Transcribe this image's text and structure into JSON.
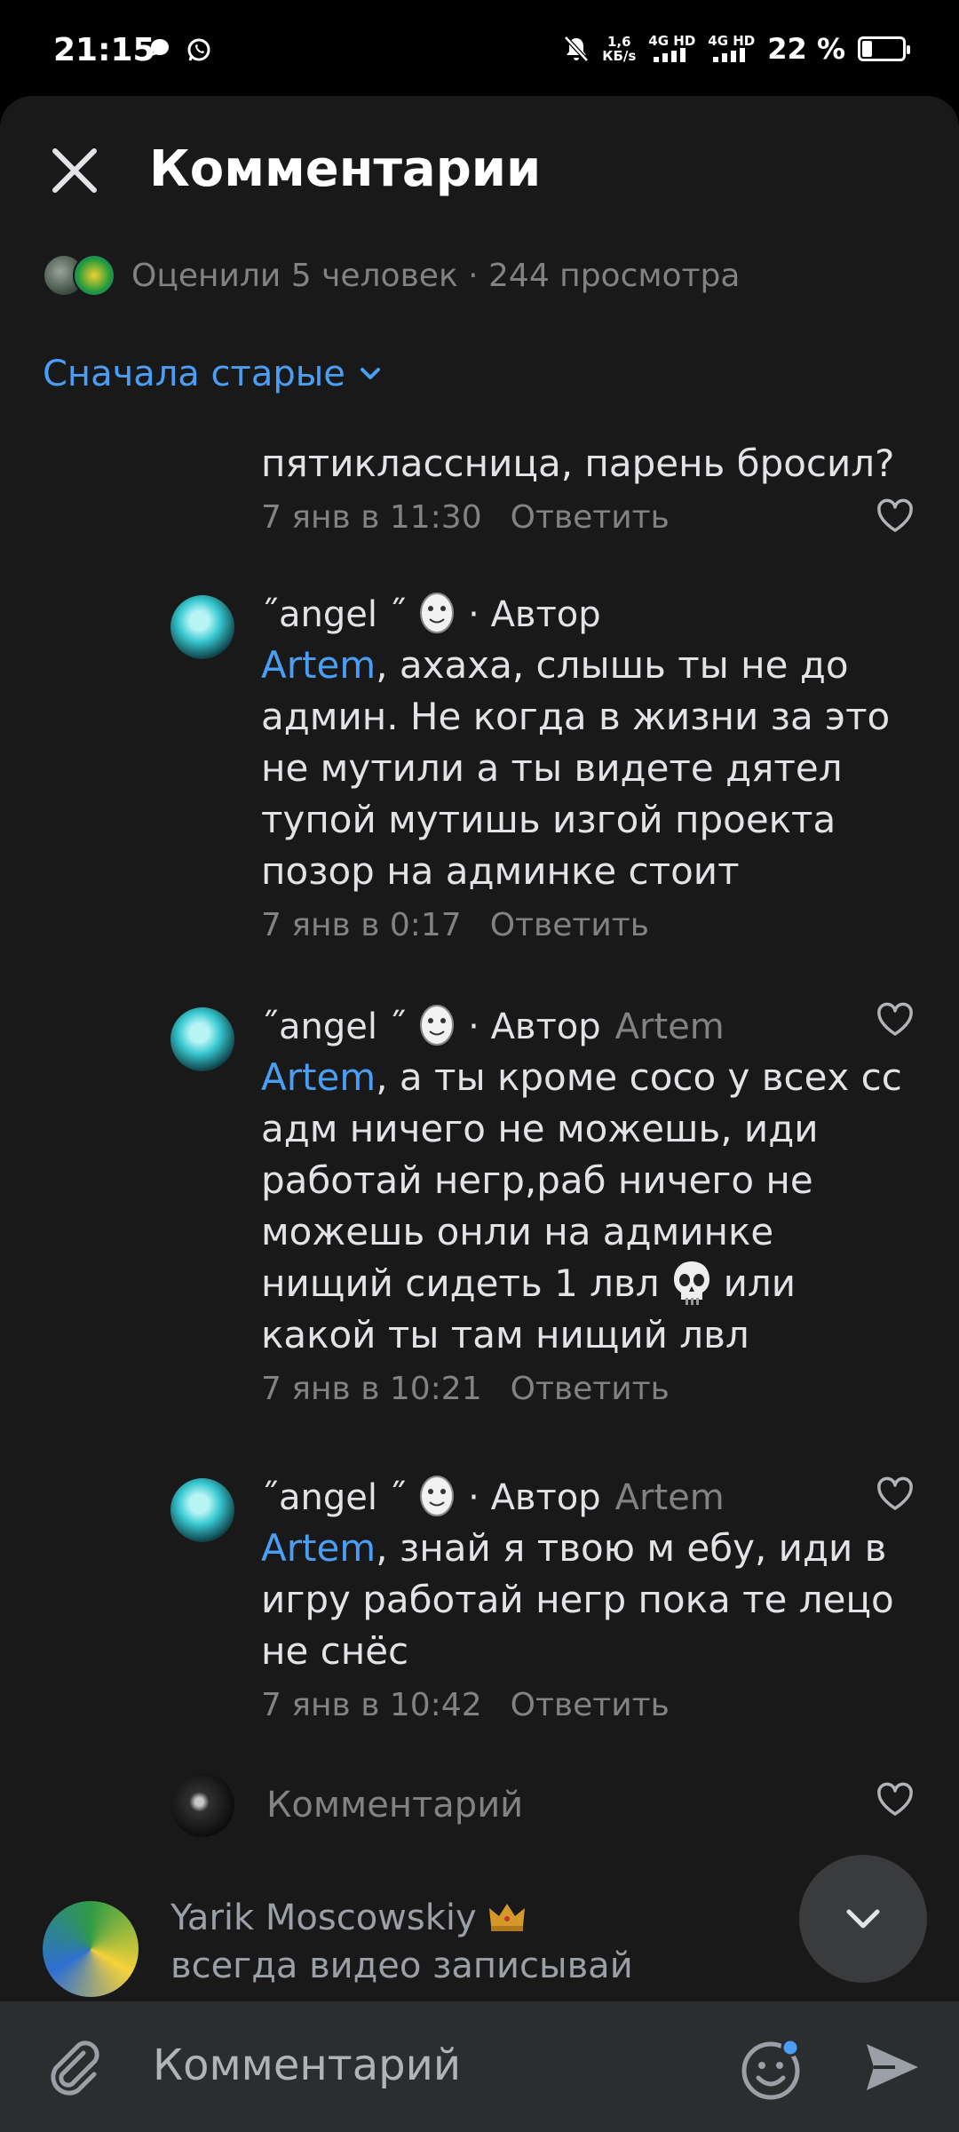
{
  "status_bar": {
    "time": "21:15",
    "net_speed": "1,6",
    "net_unit": "КБ/s",
    "sim1": "4G HD",
    "sim2": "4G HD",
    "battery": "22 %",
    "battery_level": 0.22
  },
  "header": {
    "title": "Комментарии"
  },
  "stats": {
    "text": "Оценили 5 человек · 244 просмотра"
  },
  "sort": {
    "label": "Сначала старые"
  },
  "partial_comment": {
    "text": "пятиклассница, парень бросил?",
    "time": "7 янв в 11:30",
    "reply": "Ответить"
  },
  "comments": [
    {
      "name": "˝angel ˝",
      "author_badge": "· Автор",
      "reply_to": "",
      "mention": "Artem",
      "text": ", ахаха, слышь ты не до админ. Не когда в жизни за это не мутили а ты видете дятел тупой мутишь изгой проекта позор на админке стоит",
      "time": "7 янв в 0:17",
      "reply": "Ответить"
    },
    {
      "name": "˝angel ˝",
      "author_badge": "· Автор",
      "reply_to": "Artem",
      "mention": "Artem",
      "text_before_emoji": ", а ты кроме сосо у всех сс адм ничего не можешь, иди работай негр,раб ничего не можешь онли на админке нищий сидеть 1 лвл",
      "text_after_emoji": "или какой ты там нищий лвл",
      "time": "7 янв в 10:21",
      "reply": "Ответить"
    },
    {
      "name": "˝angel ˝",
      "author_badge": "· Автор",
      "reply_to": "Artem",
      "mention": "Artem",
      "text": ", знай я твою м ебу, иди в игру работай негр пока те лецо не снёс",
      "time": "7 янв в 10:42",
      "reply": "Ответить"
    }
  ],
  "reply_prompt": {
    "placeholder": "Комментарий"
  },
  "top_comment": {
    "name": "Yarik Moscowskiy",
    "text": "всегда видео записывай"
  },
  "composer": {
    "placeholder": "Комментарий"
  },
  "colors": {
    "accent": "#4a9ef5",
    "background": "#19191a",
    "secondary_text": "#828282"
  }
}
